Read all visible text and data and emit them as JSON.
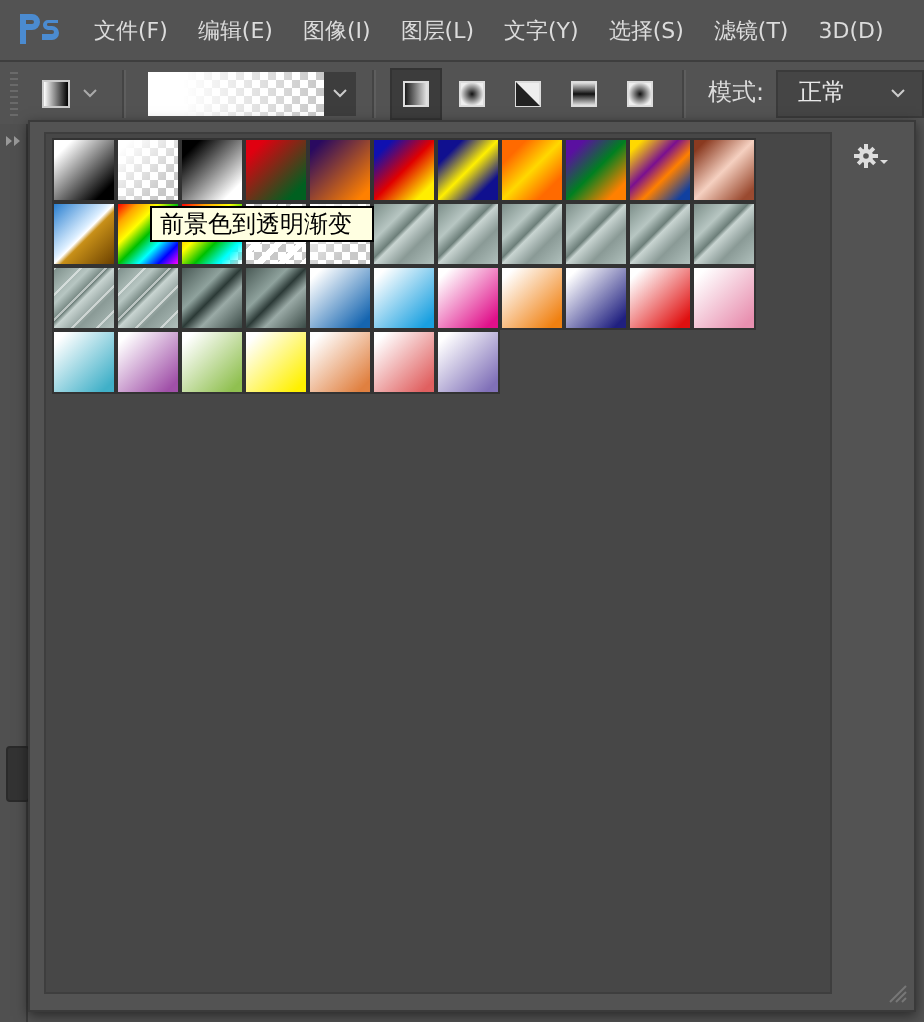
{
  "menu_bar": {
    "items": [
      "文件(F)",
      "编辑(E)",
      "图像(I)",
      "图层(L)",
      "文字(Y)",
      "选择(S)",
      "滤镜(T)",
      "3D(D)"
    ]
  },
  "options_bar": {
    "gradient_types": [
      {
        "kind": "linear",
        "selected": true
      },
      {
        "kind": "radial",
        "selected": false
      },
      {
        "kind": "angle",
        "selected": false
      },
      {
        "kind": "reflected",
        "selected": false
      },
      {
        "kind": "diamond",
        "selected": false
      }
    ],
    "mode_label": "模式:",
    "mode_value": "正常"
  },
  "gradient_picker": {
    "presets": [
      {
        "kind": "fg-bg"
      },
      {
        "kind": "fg-transparent"
      },
      {
        "kind": "black-white"
      },
      {
        "kind": "red-green"
      },
      {
        "kind": "violet-orange"
      },
      {
        "kind": "blue-red-yellow"
      },
      {
        "kind": "blue-yellow-blue"
      },
      {
        "kind": "orange-yellow"
      },
      {
        "kind": "violet-green-orange"
      },
      {
        "kind": "yellow-violet-blue"
      },
      {
        "kind": "copper"
      },
      {
        "kind": "chrome"
      },
      {
        "kind": "spectrum"
      },
      {
        "kind": "transparent-rainbow"
      },
      {
        "kind": "transparent-stripes"
      },
      {
        "kind": "neutral-density"
      },
      {
        "kind": "steel-light"
      },
      {
        "kind": "steel-light"
      },
      {
        "kind": "steel-light"
      },
      {
        "kind": "steel-light"
      },
      {
        "kind": "steel-light"
      },
      {
        "kind": "steel-light"
      },
      {
        "kind": "steel-stripe"
      },
      {
        "kind": "steel-stripe"
      },
      {
        "kind": "steel-dark"
      },
      {
        "kind": "steel-dark"
      },
      {
        "kind": "blue"
      },
      {
        "kind": "cyan"
      },
      {
        "kind": "pink"
      },
      {
        "kind": "orange"
      },
      {
        "kind": "navy"
      },
      {
        "kind": "red"
      },
      {
        "kind": "rose"
      },
      {
        "kind": "teal"
      },
      {
        "kind": "violet"
      },
      {
        "kind": "green"
      },
      {
        "kind": "yellow"
      },
      {
        "kind": "peach"
      },
      {
        "kind": "salmon"
      },
      {
        "kind": "lavender"
      }
    ],
    "tooltip": "前景色到透明渐变"
  }
}
